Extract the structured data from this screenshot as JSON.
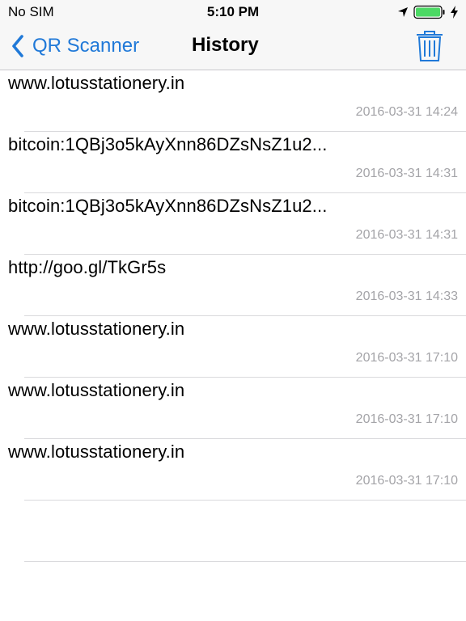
{
  "status_bar": {
    "carrier": "No SIM",
    "time": "5:10 PM"
  },
  "nav": {
    "back_label": "QR Scanner",
    "title": "History",
    "accent_color": "#2079d8"
  },
  "history": [
    {
      "text": "www.lotusstationery.in",
      "timestamp": "2016-03-31 14:24"
    },
    {
      "text": "bitcoin:1QBj3o5kAyXnn86DZsNsZ1u2...",
      "timestamp": "2016-03-31 14:31"
    },
    {
      "text": "bitcoin:1QBj3o5kAyXnn86DZsNsZ1u2...",
      "timestamp": "2016-03-31 14:31"
    },
    {
      "text": "http://goo.gl/TkGr5s",
      "timestamp": "2016-03-31 14:33"
    },
    {
      "text": "www.lotusstationery.in",
      "timestamp": "2016-03-31 17:10"
    },
    {
      "text": "www.lotusstationery.in",
      "timestamp": "2016-03-31 17:10"
    },
    {
      "text": "www.lotusstationery.in",
      "timestamp": "2016-03-31 17:10"
    }
  ],
  "icons": {
    "back": "chevron-left-icon",
    "trash": "trash-icon",
    "location": "location-arrow-icon",
    "battery": "battery-icon",
    "charging": "charging-bolt-icon"
  }
}
